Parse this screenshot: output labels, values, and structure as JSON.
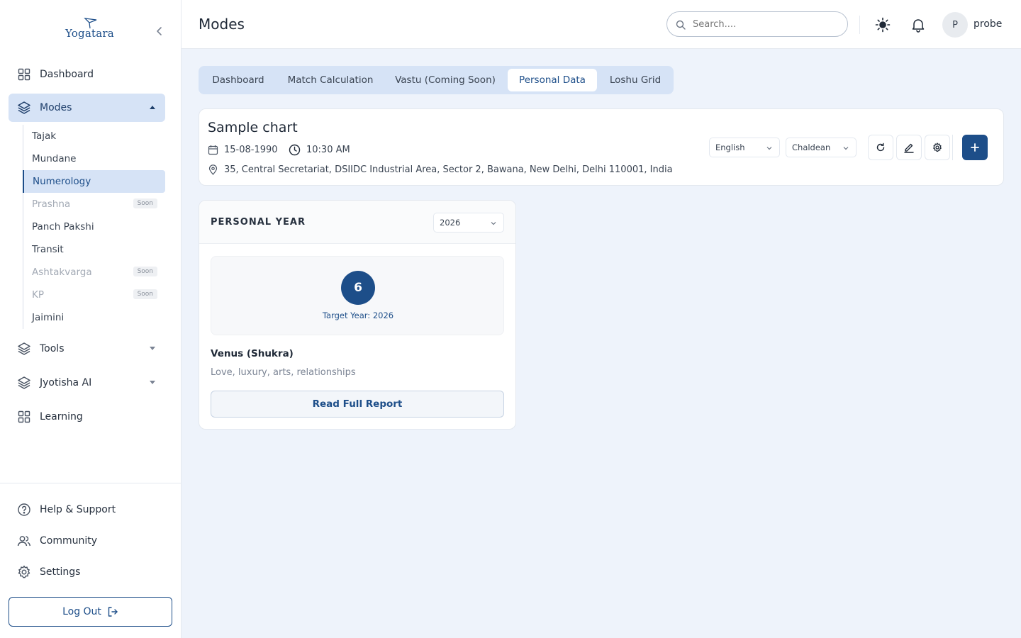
{
  "brand": {
    "name": "Yogatara"
  },
  "sidebar": {
    "nav": [
      {
        "label": "Dashboard"
      },
      {
        "label": "Modes"
      },
      {
        "label": "Tools"
      },
      {
        "label": "Jyotisha AI"
      },
      {
        "label": "Learning"
      }
    ],
    "modes_sub": [
      {
        "label": "Tajak"
      },
      {
        "label": "Mundane"
      },
      {
        "label": "Numerology"
      },
      {
        "label": "Prashna",
        "badge": "Soon"
      },
      {
        "label": "Panch Pakshi"
      },
      {
        "label": "Transit"
      },
      {
        "label": "Ashtakvarga",
        "badge": "Soon"
      },
      {
        "label": "KP",
        "badge": "Soon"
      },
      {
        "label": "Jaimini"
      }
    ],
    "footer": [
      {
        "label": "Help & Support"
      },
      {
        "label": "Community"
      },
      {
        "label": "Settings"
      }
    ],
    "logout_label": "Log Out"
  },
  "header": {
    "title": "Modes",
    "search_placeholder": "Search....",
    "user": {
      "initial": "P",
      "name": "probe"
    }
  },
  "tabs": [
    {
      "label": "Dashboard"
    },
    {
      "label": "Match Calculation"
    },
    {
      "label": "Vastu (Coming Soon)"
    },
    {
      "label": "Personal Data"
    },
    {
      "label": "Loshu Grid"
    }
  ],
  "chart": {
    "name": "Sample chart",
    "date": "15-08-1990",
    "time": "10:30 AM",
    "location": "35, Central Secretariat, DSIIDC Industrial Area, Sector 2, Bawana, New Delhi, Delhi 110001, India",
    "language": "English",
    "system": "Chaldean"
  },
  "personal_year": {
    "title": "PERSONAL YEAR",
    "selected_year": "2026",
    "number": "6",
    "target_label": "Target Year: 2026",
    "planet": "Venus (Shukra)",
    "description": "Love, luxury, arts, relationships",
    "report_button": "Read Full Report"
  },
  "colors": {
    "primary": "#1d4e89",
    "active_bg": "#d6e3f6",
    "page_bg": "#eef3fb"
  }
}
